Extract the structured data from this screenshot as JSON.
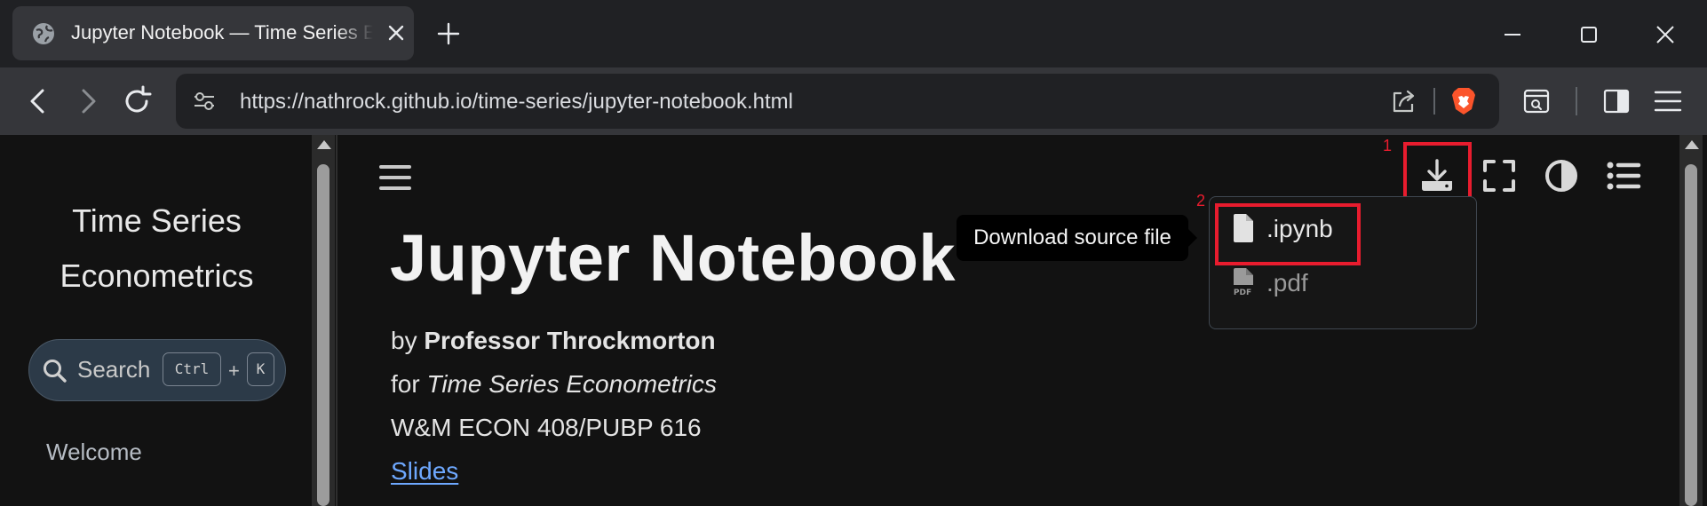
{
  "browser": {
    "tab": {
      "title": "Jupyter Notebook — Time Series Econometrics",
      "favicon": "globe-icon"
    },
    "address_bar": {
      "url": "https://nathrock.github.io/time-series/jupyter-notebook.html"
    }
  },
  "sidebar": {
    "title_line1": "Time Series",
    "title_line2": "Econometrics",
    "search": {
      "label": "Search",
      "shortcut_key1": "Ctrl",
      "shortcut_plus": "+",
      "shortcut_key2": "K"
    },
    "nav": [
      {
        "label": "Welcome"
      }
    ]
  },
  "main": {
    "title": "Jupyter Notebook",
    "by_prefix": "by",
    "author": "Professor Throckmorton",
    "for_prefix": "for",
    "course": "Time Series Econometrics",
    "course_code": "W&M ECON 408/PUBP 616",
    "link_label": "Slides"
  },
  "download_menu": {
    "tooltip": "Download source file",
    "items": [
      {
        "label": ".ipynb",
        "icon": "file-icon"
      },
      {
        "label": ".pdf",
        "icon": "pdf-file-icon"
      }
    ]
  },
  "annotations": {
    "first": "1",
    "second": "2",
    "color": "#e81c2e"
  },
  "colors": {
    "link": "#6ea8fe",
    "page_background": "#121212",
    "brave_orange": "#fb542b"
  }
}
